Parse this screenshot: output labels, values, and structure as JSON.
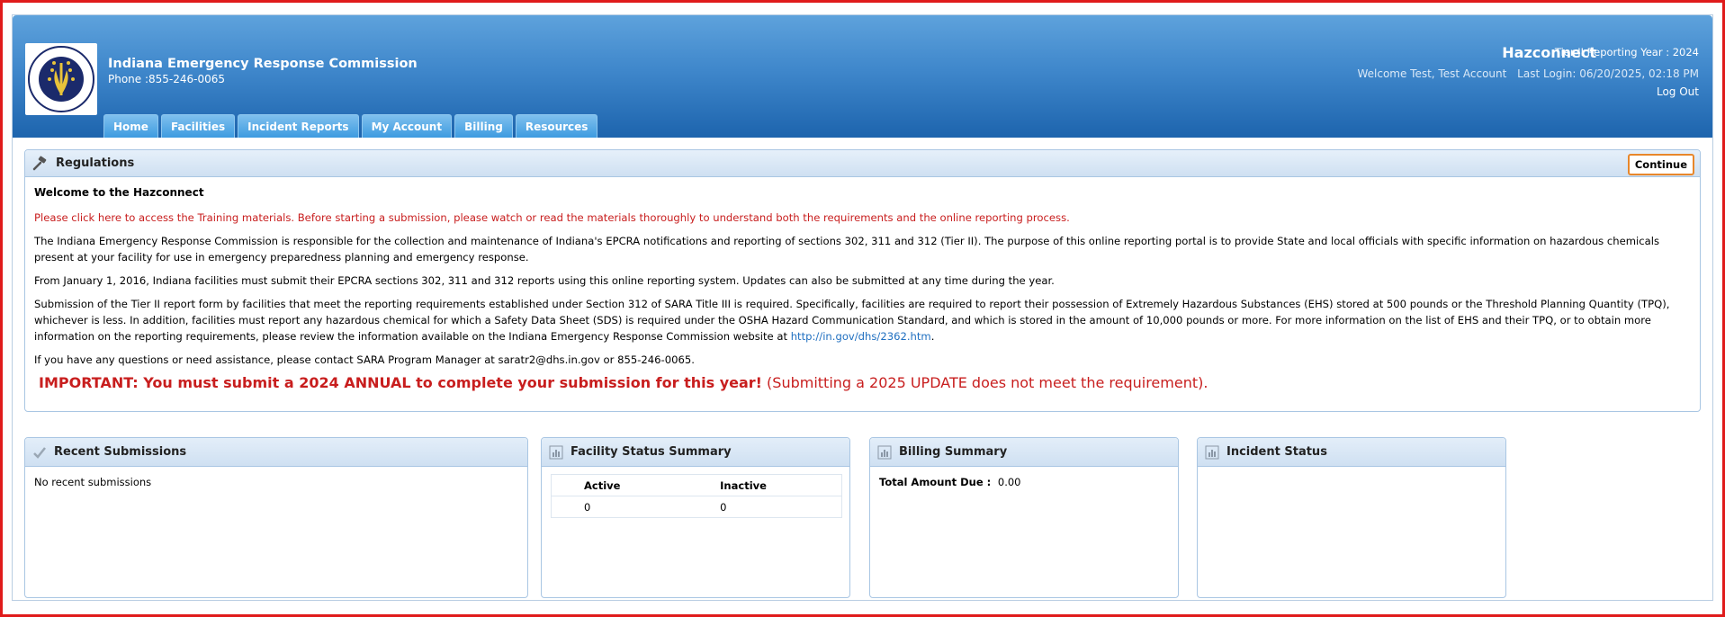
{
  "header": {
    "org_name": "Indiana Emergency Response Commission",
    "phone": "Phone :855-246-0065",
    "brand": "Hazconnect",
    "tier": "Tier II Reporting Year : 2024",
    "welcome": "Welcome Test, Test Account",
    "last_login": "Last Login: 06/20/2025, 02:18 PM",
    "logout": "Log Out",
    "logo_text": "INDIANA EMERGENCY RESPONSE COMMISSION"
  },
  "nav": {
    "tabs": [
      "Home",
      "Facilities",
      "Incident Reports",
      "My Account",
      "Billing",
      "Resources"
    ]
  },
  "regulations": {
    "title": "Regulations",
    "continue": "Continue",
    "welcome_title": "Welcome to the Hazconnect",
    "training_notice": "Please click here to access the Training materials. Before starting a submission, please watch or read the materials thoroughly to understand both the requirements and the online reporting process.",
    "para1": "The Indiana Emergency Response Commission is responsible for the collection and maintenance of Indiana's EPCRA notifications and reporting of sections 302, 311 and 312 (Tier II). The purpose of this online reporting portal is to provide State and local officials with specific information on hazardous chemicals present at your facility for use in emergency preparedness planning and emergency response.",
    "para2": "From January 1, 2016, Indiana facilities must submit their EPCRA sections 302, 311 and 312 reports using this online reporting system. Updates can also be submitted at any time during the year.",
    "para3": "Submission of the Tier II report form by facilities that meet the reporting requirements established under Section 312 of SARA Title III is required. Specifically, facilities are required to report their possession of Extremely Hazardous Substances (EHS) stored at 500 pounds or the Threshold Planning Quantity (TPQ), whichever is less. In addition, facilities must report any hazardous chemical for which a Safety Data Sheet (SDS) is required under the OSHA Hazard Communication Standard, and which is stored in the amount of 10,000 pounds or more. For more information on the list of EHS and their TPQ, or to obtain more information on the reporting requirements, please review the information available on the Indiana Emergency Response Commission website at",
    "para3_link": "http://in.gov/dhs/2362.htm",
    "para3_end": ".",
    "para4": "If you have any questions or need assistance, please contact SARA Program Manager at saratr2@dhs.in.gov or 855-246-0065.",
    "important_bold": "IMPORTANT: You must submit a 2024 ANNUAL to complete your submission for this year!",
    "important_rest": "(Submitting a 2025 UPDATE does not meet the requirement)."
  },
  "widgets": {
    "recent": {
      "title": "Recent Submissions",
      "empty": "No recent submissions"
    },
    "facility": {
      "title": "Facility Status Summary",
      "headers": [
        "Active",
        "Inactive"
      ],
      "values": [
        "0",
        "0"
      ]
    },
    "billing": {
      "title": "Billing Summary",
      "label": "Total Amount Due :",
      "value": "0.00"
    },
    "incident": {
      "title": "Incident Status"
    }
  },
  "colors": {
    "header_blue": "#3f87cb",
    "alert_red": "#c81e1e",
    "link_blue": "#1f6fc0",
    "frame_red": "#e01b1b"
  }
}
